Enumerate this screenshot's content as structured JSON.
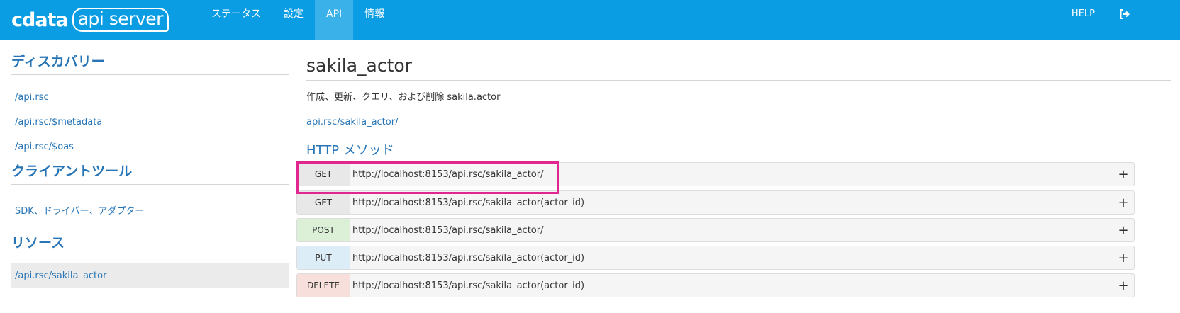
{
  "brand": {
    "logo_brand": "cdata",
    "logo_product": "api server"
  },
  "nav": {
    "tabs": [
      {
        "label": "ステータス"
      },
      {
        "label": "設定"
      },
      {
        "label": "API"
      },
      {
        "label": "情報"
      }
    ],
    "active_tab": "API",
    "help_label": "HELP",
    "logout_icon": "logout-icon"
  },
  "sidebar": {
    "sections": [
      {
        "heading": "ディスカバリー",
        "links": [
          "/api.rsc",
          "/api.rsc/$metadata",
          "/api.rsc/$oas"
        ]
      },
      {
        "heading": "クライアントツール",
        "links": [
          "SDK、ドライバー、アダプター"
        ]
      },
      {
        "heading": "リソース",
        "links": [
          "/api.rsc/sakila_actor"
        ]
      }
    ],
    "selected_link": "/api.rsc/sakila_actor"
  },
  "main": {
    "title": "sakila_actor",
    "description": "作成、更新、クエリ、および削除 sakila.actor",
    "endpoint": "api.rsc/sakila_actor/",
    "methods_title": "HTTP メソッド",
    "methods": [
      {
        "method": "GET",
        "url": "http://localhost:8153/api.rsc/sakila_actor/",
        "color": "#e8e8e8"
      },
      {
        "method": "GET",
        "url": "http://localhost:8153/api.rsc/sakila_actor(actor_id)",
        "color": "#e8e8e8"
      },
      {
        "method": "POST",
        "url": "http://localhost:8153/api.rsc/sakila_actor/",
        "color": "#dcf0d8"
      },
      {
        "method": "PUT",
        "url": "http://localhost:8153/api.rsc/sakila_actor(actor_id)",
        "color": "#dcedf7"
      },
      {
        "method": "DELETE",
        "url": "http://localhost:8153/api.rsc/sakila_actor(actor_id)",
        "color": "#f7dfdb"
      }
    ],
    "expand_symbol": "+"
  },
  "colors": {
    "navbar": "#0a9de3",
    "active_tab": "#3bb1ea",
    "link": "#2775b6",
    "highlight": "#e0268f"
  }
}
